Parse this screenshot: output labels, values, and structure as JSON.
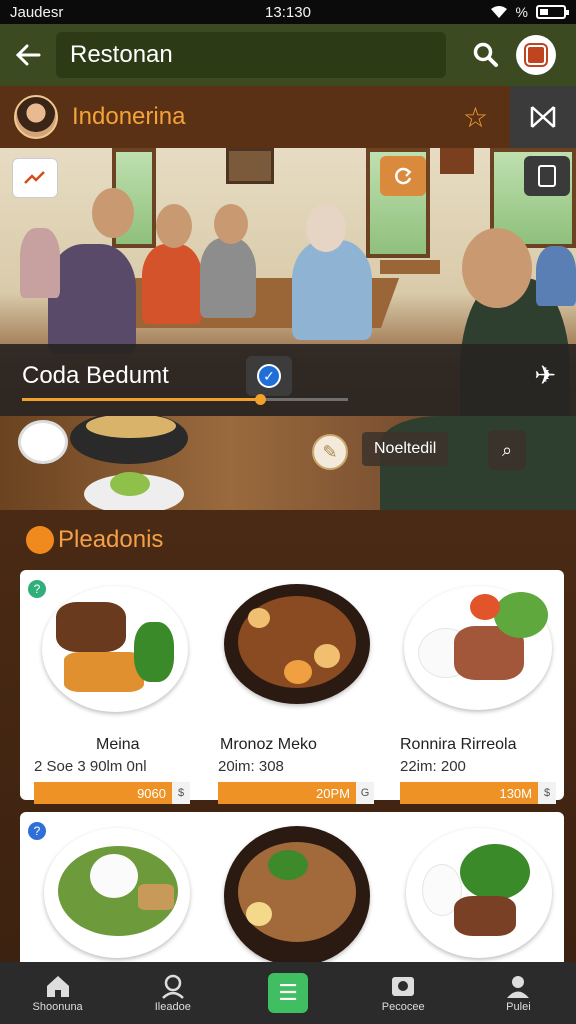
{
  "status_bar": {
    "carrier": "Jaudesr",
    "time": "13:130",
    "signal_text": "%"
  },
  "app_bar": {
    "title": "Restonan"
  },
  "location": {
    "name": "Indonerina"
  },
  "restaurant": {
    "name": "Coda Bedumt",
    "progress": 0.73
  },
  "photo_tag": {
    "label": "Noeltedil"
  },
  "section": {
    "title": "Pleadonis"
  },
  "menu": [
    {
      "name": "Meina",
      "price": "2 Soe 3 90lm 0nl",
      "bar_value": "9060",
      "bar_icon": "$",
      "badge": "?"
    },
    {
      "name": "Mronoz Meko",
      "price": "20im: 308",
      "bar_value": "20PM",
      "bar_icon": "G",
      "badge": ""
    },
    {
      "name": "Ronnira Rirreola",
      "price": "22im: 200",
      "bar_value": "130M",
      "bar_icon": "$",
      "badge": ""
    }
  ],
  "menu_row2_badge": "?",
  "bottom_nav": [
    {
      "label": "Shoonuna",
      "icon": "home-icon"
    },
    {
      "label": "Ileadoe",
      "icon": "profile-icon"
    },
    {
      "label": "",
      "icon": "menu-list-icon"
    },
    {
      "label": "Pecocee",
      "icon": "camera-icon"
    },
    {
      "label": "Pulei",
      "icon": "user-icon"
    }
  ],
  "colors": {
    "appbar": "#3b4a21",
    "accent": "#f4a33a",
    "nav_center": "#3fbf62",
    "badge_green": "#2fb07a",
    "badge_blue": "#2f6fd8"
  }
}
